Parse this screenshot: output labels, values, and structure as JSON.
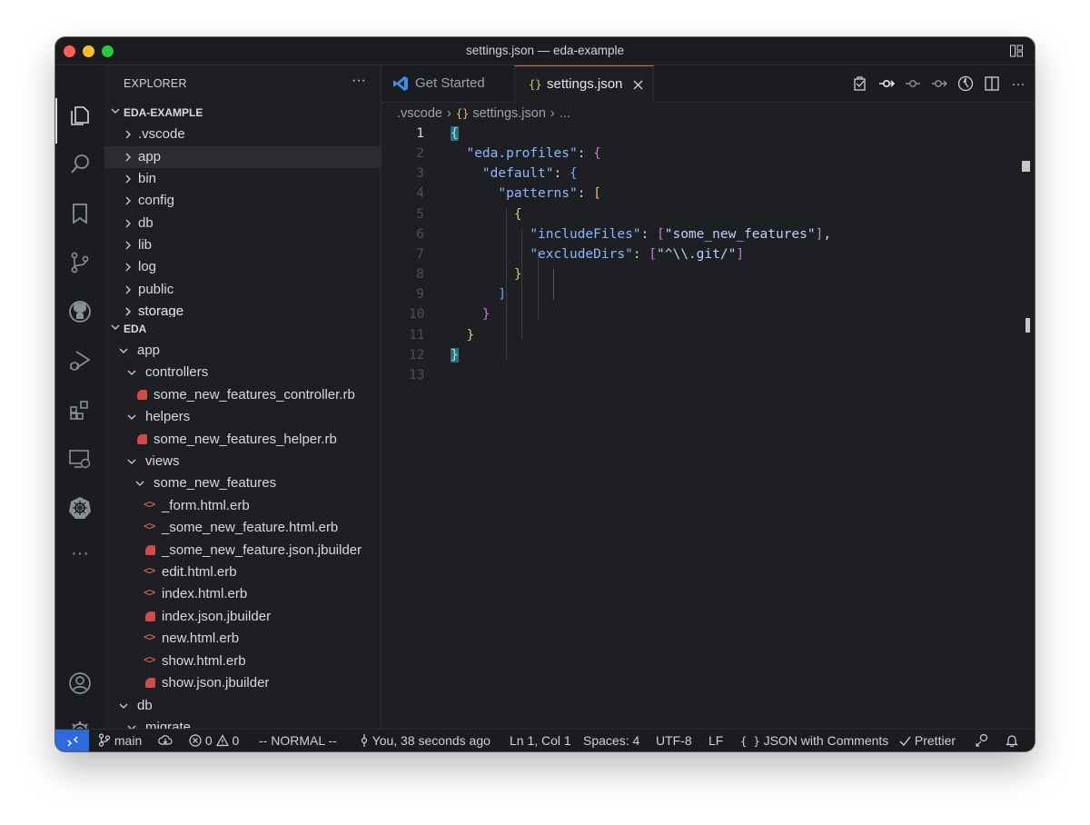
{
  "window": {
    "title": "settings.json — eda-example"
  },
  "sidebar": {
    "title": "EXPLORER",
    "more": "···",
    "sections": [
      {
        "name": "EDA-EXAMPLE",
        "items": [
          ".vscode",
          "app",
          "bin",
          "config",
          "db",
          "lib",
          "log",
          "public",
          "storage"
        ]
      },
      {
        "name": "EDA",
        "items": [
          "app",
          "controllers",
          "some_new_features_controller.rb",
          "helpers",
          "some_new_features_helper.rb",
          "views",
          "some_new_features",
          "_form.html.erb",
          "_some_new_feature.html.erb",
          "_some_new_feature.json.jbuilder",
          "edit.html.erb",
          "index.html.erb",
          "index.json.jbuilder",
          "new.html.erb",
          "show.html.erb",
          "show.json.jbuilder",
          "db",
          "migrate"
        ]
      }
    ]
  },
  "tabs": [
    {
      "label": "Get Started",
      "active": false
    },
    {
      "label": "settings.json",
      "active": true,
      "icon": "{}"
    }
  ],
  "breadcrumb": [
    ".vscode",
    "settings.json",
    "..."
  ],
  "editor": {
    "line_numbers": [
      "1",
      "2",
      "3",
      "4",
      "5",
      "6",
      "7",
      "8",
      "9",
      "10",
      "11",
      "12",
      "13"
    ],
    "code": {
      "l2_key": "\"eda.profiles\"",
      "l3_key": "\"default\"",
      "l4_key": "\"patterns\"",
      "l6_key": "\"includeFiles\"",
      "l6_val": "\"some_new_features\"",
      "l7_key": "\"excludeDirs\"",
      "l7_val": "\"^\\\\.git/\""
    }
  },
  "statusbar": {
    "branch": "main",
    "errors": "0",
    "warnings": "0",
    "mode": "-- NORMAL --",
    "blame": "You, 38 seconds ago",
    "position": "Ln 1, Col 1",
    "spaces": "Spaces: 4",
    "encoding": "UTF-8",
    "eol": "LF",
    "language": "JSON with Comments",
    "language_icon": "{ }",
    "formatter": "Prettier"
  },
  "colors": {
    "accent": "#d66a4d",
    "remote": "#2d6bdc",
    "background": "#1e1f22"
  }
}
